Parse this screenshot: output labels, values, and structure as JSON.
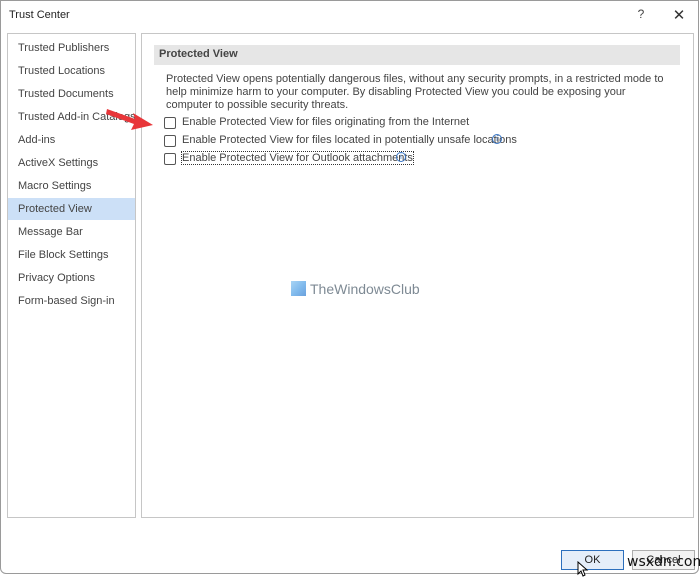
{
  "window": {
    "title": "Trust Center",
    "help_label": "?",
    "close_label": "✕",
    "help_icon": "question-mark-icon",
    "close_icon": "close-icon"
  },
  "sidebar": {
    "selected": "Protected View",
    "items": [
      {
        "label": "Trusted Publishers"
      },
      {
        "label": "Trusted Locations"
      },
      {
        "label": "Trusted Documents"
      },
      {
        "label": "Trusted Add-in Catalogs"
      },
      {
        "label": "Add-ins"
      },
      {
        "label": "ActiveX Settings"
      },
      {
        "label": "Macro Settings"
      },
      {
        "label": "Protected View"
      },
      {
        "label": "Message Bar"
      },
      {
        "label": "File Block Settings"
      },
      {
        "label": "Privacy Options"
      },
      {
        "label": "Form-based Sign-in"
      }
    ]
  },
  "main": {
    "section_title": "Protected View",
    "description": "Protected View opens potentially dangerous files, without any security prompts, in a restricted mode to help minimize harm to your computer. By disabling Protected View you could be exposing your computer to possible security threats.",
    "options": [
      {
        "label": "Enable Protected View for files originating from the Internet",
        "checked": false,
        "info_icon": false
      },
      {
        "label": "Enable Protected View for files located in potentially unsafe locations",
        "checked": false,
        "info_icon": true
      },
      {
        "label": "Enable Protected View for Outlook attachments",
        "checked": false,
        "info_icon": true,
        "focused": true
      }
    ],
    "info_glyph": "i"
  },
  "watermark": {
    "text": "TheWindowsClub",
    "icon": "thewindowsclub-logo-icon"
  },
  "annotation": {
    "arrow_color": "#e8363a",
    "arrow_icon": "red-arrow-icon"
  },
  "footer": {
    "ok_label": "OK",
    "cancel_label": "Cancel"
  },
  "overlay": {
    "site_watermark": "wsxdn.com"
  },
  "colors": {
    "selected_item_bg": "#cce0f7",
    "section_header_bg": "#e6e6e6",
    "ok_border": "#2c6fbd",
    "info_icon": "#3a78c9"
  }
}
